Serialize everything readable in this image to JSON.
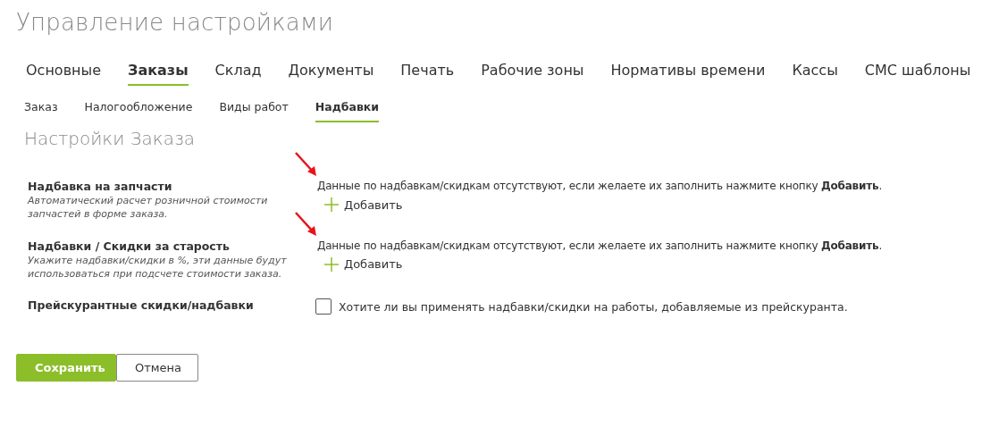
{
  "page_title": "Управление настройками",
  "tabs": [
    {
      "label": "Основные",
      "selected": false
    },
    {
      "label": "Заказы",
      "selected": true
    },
    {
      "label": "Склад",
      "selected": false
    },
    {
      "label": "Документы",
      "selected": false
    },
    {
      "label": "Печать",
      "selected": false
    },
    {
      "label": "Рабочие зоны",
      "selected": false
    },
    {
      "label": "Нормативы времени",
      "selected": false
    },
    {
      "label": "Кассы",
      "selected": false
    },
    {
      "label": "СМС шаблоны",
      "selected": false
    }
  ],
  "subtabs": [
    {
      "label": "Заказ",
      "selected": false
    },
    {
      "label": "Налогообложение",
      "selected": false
    },
    {
      "label": "Виды работ",
      "selected": false
    },
    {
      "label": "Надбавки",
      "selected": true
    }
  ],
  "section_title": "Настройки Заказа",
  "settings": [
    {
      "kind": "add",
      "label": "Надбавка на запчасти",
      "description": "Автоматический расчет розничной стоимости запчастей в форме заказа.",
      "message": "Данные по надбавкам/скидкам отсутствуют, если желаете их заполнить нажмите кнопку **Добавить**.",
      "button": "Добавить",
      "annotated": true
    },
    {
      "kind": "add",
      "label": "Надбавки / Скидки за старость",
      "description": "Укажите надбавки/скидки в %, эти данные будут использоваться при подсчете стоимости заказа.",
      "message": "Данные по надбавкам/скидкам отсутствуют, если желаете их заполнить нажмите кнопку **Добавить**.",
      "button": "Добавить",
      "annotated": true
    },
    {
      "kind": "checkbox",
      "label": "Прейскурантные скидки/надбавки",
      "checkbox_label": "Хотите ли вы применять надбавки/скидки на работы, добавляемые из прейскуранта.",
      "checked": false
    }
  ],
  "buttons": [
    {
      "label": "Сохранить",
      "kind": "primary"
    },
    {
      "label": "Отмена",
      "kind": "secondary"
    }
  ]
}
